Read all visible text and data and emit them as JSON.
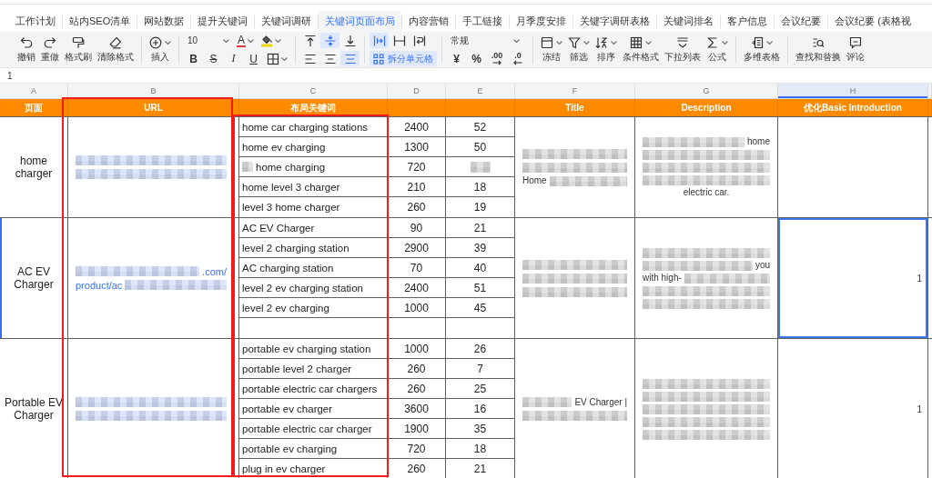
{
  "tabs": [
    {
      "label": "工作计划",
      "selected": false
    },
    {
      "label": "站内SEO清单",
      "selected": false
    },
    {
      "label": "网站数据",
      "selected": false
    },
    {
      "label": "提升关键词",
      "selected": false
    },
    {
      "label": "关键词调研",
      "selected": false
    },
    {
      "label": "关键词页面布局",
      "selected": true
    },
    {
      "label": "内容营销",
      "selected": false
    },
    {
      "label": "手工链接",
      "selected": false
    },
    {
      "label": "月季度安排",
      "selected": false
    },
    {
      "label": "关键字调研表格",
      "selected": false
    },
    {
      "label": "关键词排名",
      "selected": false
    },
    {
      "label": "客户信息",
      "selected": false
    },
    {
      "label": "会议纪要",
      "selected": false
    },
    {
      "label": "会议纪要 (表格视",
      "selected": false
    }
  ],
  "toolbar": {
    "edit_tools": [
      {
        "label": "撤销"
      },
      {
        "label": "重做"
      },
      {
        "label": "格式刷"
      },
      {
        "label": "清除格式"
      }
    ],
    "insert_tools": [
      {
        "label": "插入",
        "dropdown": true
      }
    ],
    "font": {
      "size": "10",
      "color_glyph": "A",
      "styles": [
        {
          "glyph": "B",
          "selected": false
        },
        {
          "glyph": "S",
          "selected": false
        },
        {
          "glyph": "I",
          "selected": false
        },
        {
          "glyph": "U",
          "selected": false
        }
      ]
    },
    "vertical_align": [
      {
        "selected": false
      },
      {
        "selected": true
      },
      {
        "selected": false
      }
    ],
    "horizontal_align": [
      {
        "selected": false
      },
      {
        "selected": false
      },
      {
        "selected": true
      }
    ],
    "merge_options": [
      {
        "selected": true
      },
      {
        "selected": false
      },
      {
        "selected": false
      }
    ],
    "split_cells": {
      "label": "拆分单元格",
      "selected": true
    },
    "number_format": {
      "value": "常规",
      "currency_glyph": "¥",
      "percent_glyph": "%",
      "add_decimal_glyph": ".00",
      "remove_decimal_glyph": ".0"
    },
    "data_tools": [
      {
        "label": "冻结",
        "dropdown": true
      },
      {
        "label": "筛选",
        "dropdown": true
      },
      {
        "label": "排序",
        "dropdown": true
      },
      {
        "label": "条件格式",
        "dropdown": true
      },
      {
        "label": "下拉列表",
        "dropdown": false
      },
      {
        "label": "公式",
        "dropdown": true
      }
    ],
    "table_tools": [
      {
        "label": "多维表格",
        "dropdown": true
      }
    ],
    "review_tools": [
      {
        "label": "查找和替换"
      },
      {
        "label": "评论"
      }
    ]
  },
  "formula_bar": {
    "value": "1"
  },
  "sheet": {
    "columns": [
      {
        "letter": "A",
        "heading": "页面",
        "selected": false,
        "framed": false
      },
      {
        "letter": "B",
        "heading": "URL",
        "selected": false,
        "framed": true,
        "frame_includes_heading": true
      },
      {
        "letter": "C",
        "heading": "布局关键词",
        "selected": false,
        "framed": true,
        "frame_includes_heading": false
      },
      {
        "letter": "D",
        "selected": false,
        "framed": false
      },
      {
        "letter": "E",
        "selected": false,
        "framed": false
      },
      {
        "letter": "F",
        "heading": "Title",
        "selected": false,
        "framed": false
      },
      {
        "letter": "G",
        "heading": "Description",
        "selected": false,
        "framed": false
      },
      {
        "letter": "H",
        "heading": "优化Basic Introduction",
        "selected": true,
        "framed": false
      }
    ],
    "groups": [
      {
        "page": "home charger",
        "selected": false,
        "url": [
          [
            {
              "kind": "blur"
            }
          ],
          [
            {
              "kind": "blur"
            }
          ]
        ],
        "keywords": [
          {
            "kind": "keyword",
            "keyword": "home car charging stations",
            "keyword_blurred": false,
            "column_d": "2400",
            "column_e": "52",
            "column_e_blurred": false
          },
          {
            "kind": "keyword",
            "keyword": "home ev charging",
            "keyword_blurred": false,
            "column_d": "1300",
            "column_e": "50",
            "column_e_blurred": false
          },
          {
            "kind": "keyword",
            "keyword": "home charging",
            "keyword_blurred": true,
            "column_d": "720",
            "column_e_blurred": true
          },
          {
            "kind": "keyword",
            "keyword": "home level 3 charger",
            "keyword_blurred": false,
            "column_d": "210",
            "column_e": "18",
            "column_e_blurred": false
          },
          {
            "kind": "keyword",
            "keyword": "level 3 home charger",
            "keyword_blurred": false,
            "column_d": "260",
            "column_e": "19",
            "column_e_blurred": false
          }
        ],
        "title": [
          [
            {
              "kind": "blur"
            }
          ],
          [
            {
              "kind": "blur"
            }
          ],
          [
            {
              "kind": "text",
              "text": "Home"
            },
            {
              "kind": "blur"
            }
          ]
        ],
        "description": [
          [
            {
              "kind": "blur"
            },
            {
              "kind": "text",
              "text": "home"
            }
          ],
          [
            {
              "kind": "blur"
            }
          ],
          [
            {
              "kind": "blur"
            }
          ],
          [
            {
              "kind": "blur"
            }
          ],
          [
            {
              "kind": "text",
              "text": "electric car."
            }
          ]
        ]
      },
      {
        "page": "AC EV Charger",
        "selected": true,
        "url": [
          [
            {
              "kind": "blur"
            },
            {
              "kind": "text",
              "text": ".com/"
            }
          ],
          [
            {
              "kind": "text",
              "text": "product/ac"
            },
            {
              "kind": "blur"
            }
          ]
        ],
        "keywords": [
          {
            "kind": "keyword",
            "keyword": "AC EV Charger",
            "keyword_blurred": false,
            "column_d": "90",
            "column_e": "21",
            "column_e_blurred": false
          },
          {
            "kind": "keyword",
            "keyword": "level 2 charging station",
            "keyword_blurred": false,
            "column_d": "2900",
            "column_e": "39",
            "column_e_blurred": false
          },
          {
            "kind": "keyword",
            "keyword": "AC charging station",
            "keyword_blurred": false,
            "column_d": "70",
            "column_e": "40",
            "column_e_blurred": false
          },
          {
            "kind": "keyword",
            "keyword": "level 2 ev charging station",
            "keyword_blurred": false,
            "column_d": "2400",
            "column_e": "51",
            "column_e_blurred": false
          },
          {
            "kind": "keyword",
            "keyword": "level 2 ev charging",
            "keyword_blurred": false,
            "column_d": "1000",
            "column_e": "45",
            "column_e_blurred": false
          },
          {
            "kind": "blank"
          }
        ],
        "title": [
          [
            {
              "kind": "blur"
            }
          ],
          [
            {
              "kind": "blur"
            }
          ],
          [
            {
              "kind": "blur"
            }
          ]
        ],
        "description": [
          [
            {
              "kind": "blur"
            }
          ],
          [
            {
              "kind": "blur"
            },
            {
              "kind": "text",
              "text": "you"
            }
          ],
          [
            {
              "kind": "text",
              "text": "with high-"
            },
            {
              "kind": "blur"
            }
          ],
          [
            {
              "kind": "blur"
            }
          ],
          [
            {
              "kind": "blur"
            }
          ]
        ],
        "introduction": "1"
      },
      {
        "page": "Portable EV Charger",
        "selected": false,
        "url": [
          [
            {
              "kind": "blur"
            }
          ],
          [
            {
              "kind": "blur"
            }
          ]
        ],
        "keywords": [
          {
            "kind": "keyword",
            "keyword": "portable ev charging station",
            "keyword_blurred": false,
            "column_d": "1000",
            "column_e": "26",
            "column_e_blurred": false
          },
          {
            "kind": "keyword",
            "keyword": "portable level 2 charger",
            "keyword_blurred": false,
            "column_d": "260",
            "column_e": "7",
            "column_e_blurred": false
          },
          {
            "kind": "keyword",
            "keyword": "portable electric car chargers",
            "keyword_blurred": false,
            "column_d": "260",
            "column_e": "25",
            "column_e_blurred": false
          },
          {
            "kind": "keyword",
            "keyword": "portable ev charger",
            "keyword_blurred": false,
            "column_d": "3600",
            "column_e": "16",
            "column_e_blurred": false
          },
          {
            "kind": "keyword",
            "keyword": "portable electric car charger",
            "keyword_blurred": false,
            "column_d": "1900",
            "column_e": "35",
            "column_e_blurred": false
          },
          {
            "kind": "keyword",
            "keyword": "portable ev charging",
            "keyword_blurred": false,
            "column_d": "720",
            "column_e": "18",
            "column_e_blurred": false
          },
          {
            "kind": "keyword",
            "keyword": "plug in ev charger",
            "keyword_blurred": false,
            "column_d": "260",
            "column_e": "21",
            "column_e_blurred": false
          }
        ],
        "title": [
          [
            {
              "kind": "blur"
            },
            {
              "kind": "text",
              "text": "EV Charger |"
            }
          ],
          [
            {
              "kind": "blur"
            }
          ]
        ],
        "description": [
          [
            {
              "kind": "blur"
            }
          ],
          [
            {
              "kind": "blur"
            }
          ],
          [
            {
              "kind": "blur"
            }
          ],
          [
            {
              "kind": "blur"
            }
          ],
          [
            {
              "kind": "blur"
            }
          ]
        ],
        "introduction": "1"
      }
    ]
  }
}
